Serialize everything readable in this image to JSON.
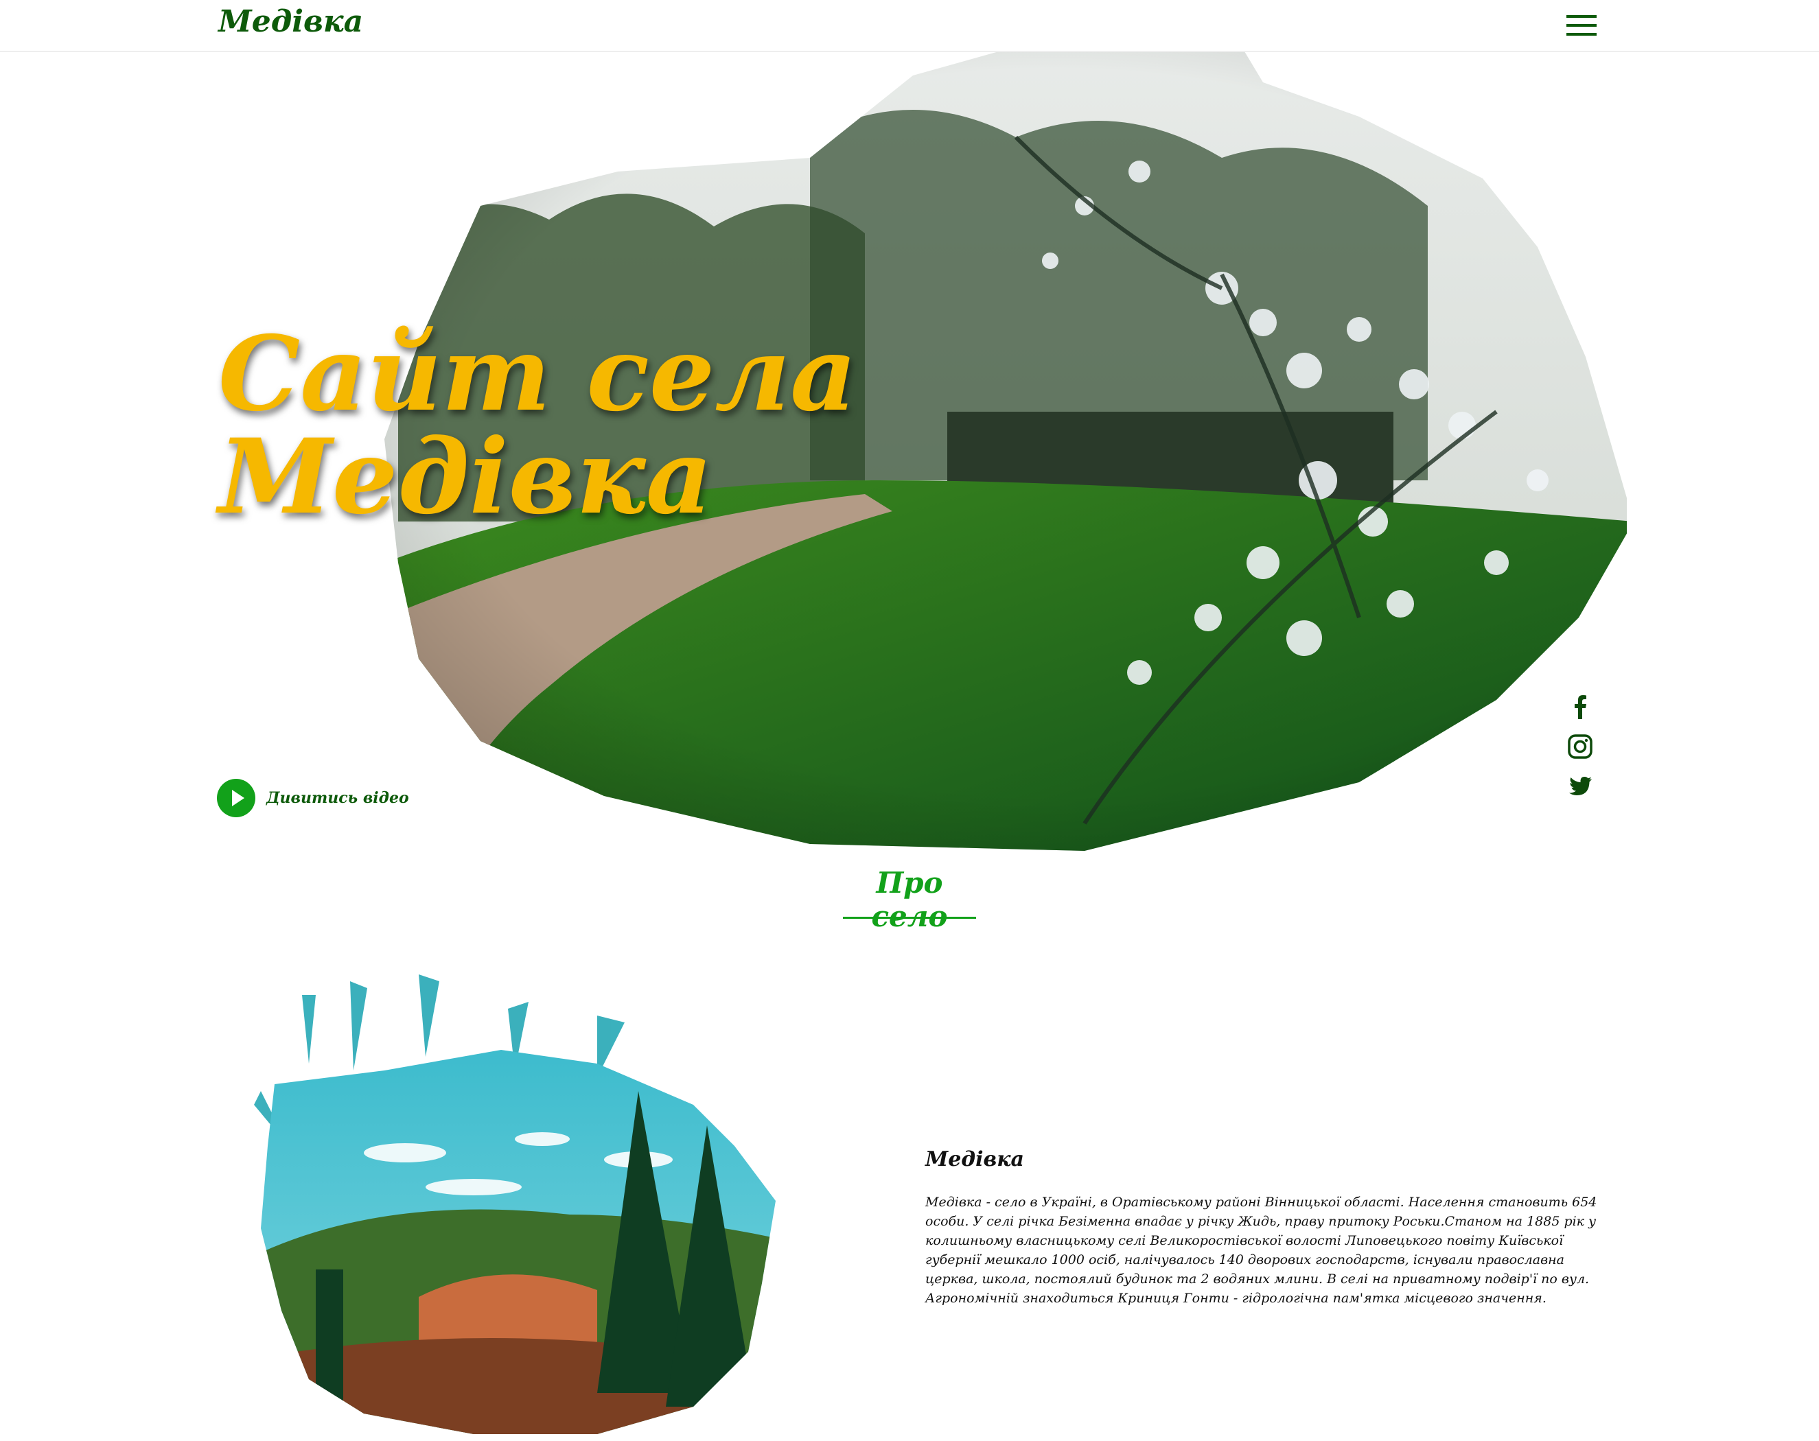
{
  "header": {
    "logo": "Медівка",
    "menu_icon": "hamburger-menu-icon"
  },
  "hero": {
    "title_line1": "Сайт села",
    "title_line2": "Медівка",
    "play_label": "Дивитись відео",
    "play_icon": "play-icon"
  },
  "socials": {
    "items": [
      "facebook-icon",
      "instagram-icon",
      "twitter-icon"
    ]
  },
  "about": {
    "heading": "Про село",
    "village_title": "Медівка",
    "text": "Медівка - село в Україні, в Оратівському районі Вінницької області. Населення становить 654 особи. У селі річка Безіменна впадає у річку Жидь, праву притоку Роськи.Станом на 1885 рік у колишньому власницькому селі Великоростівської волості Липовецького повіту Київської губернії мешкало 1000 осіб, налічувалось 140 дворових господарств, існували православна церква, школа, постоялий будинок та 2 водяних млини. В селі на приватному подвір'ї по вул. Агрономічній знаходиться Криниця Гонти - гідрологічна пам'ятка місцевого значення."
  },
  "colors": {
    "brand_green": "#0d5a0a",
    "accent_green": "#12a11a",
    "title_yellow": "#f6b800"
  }
}
